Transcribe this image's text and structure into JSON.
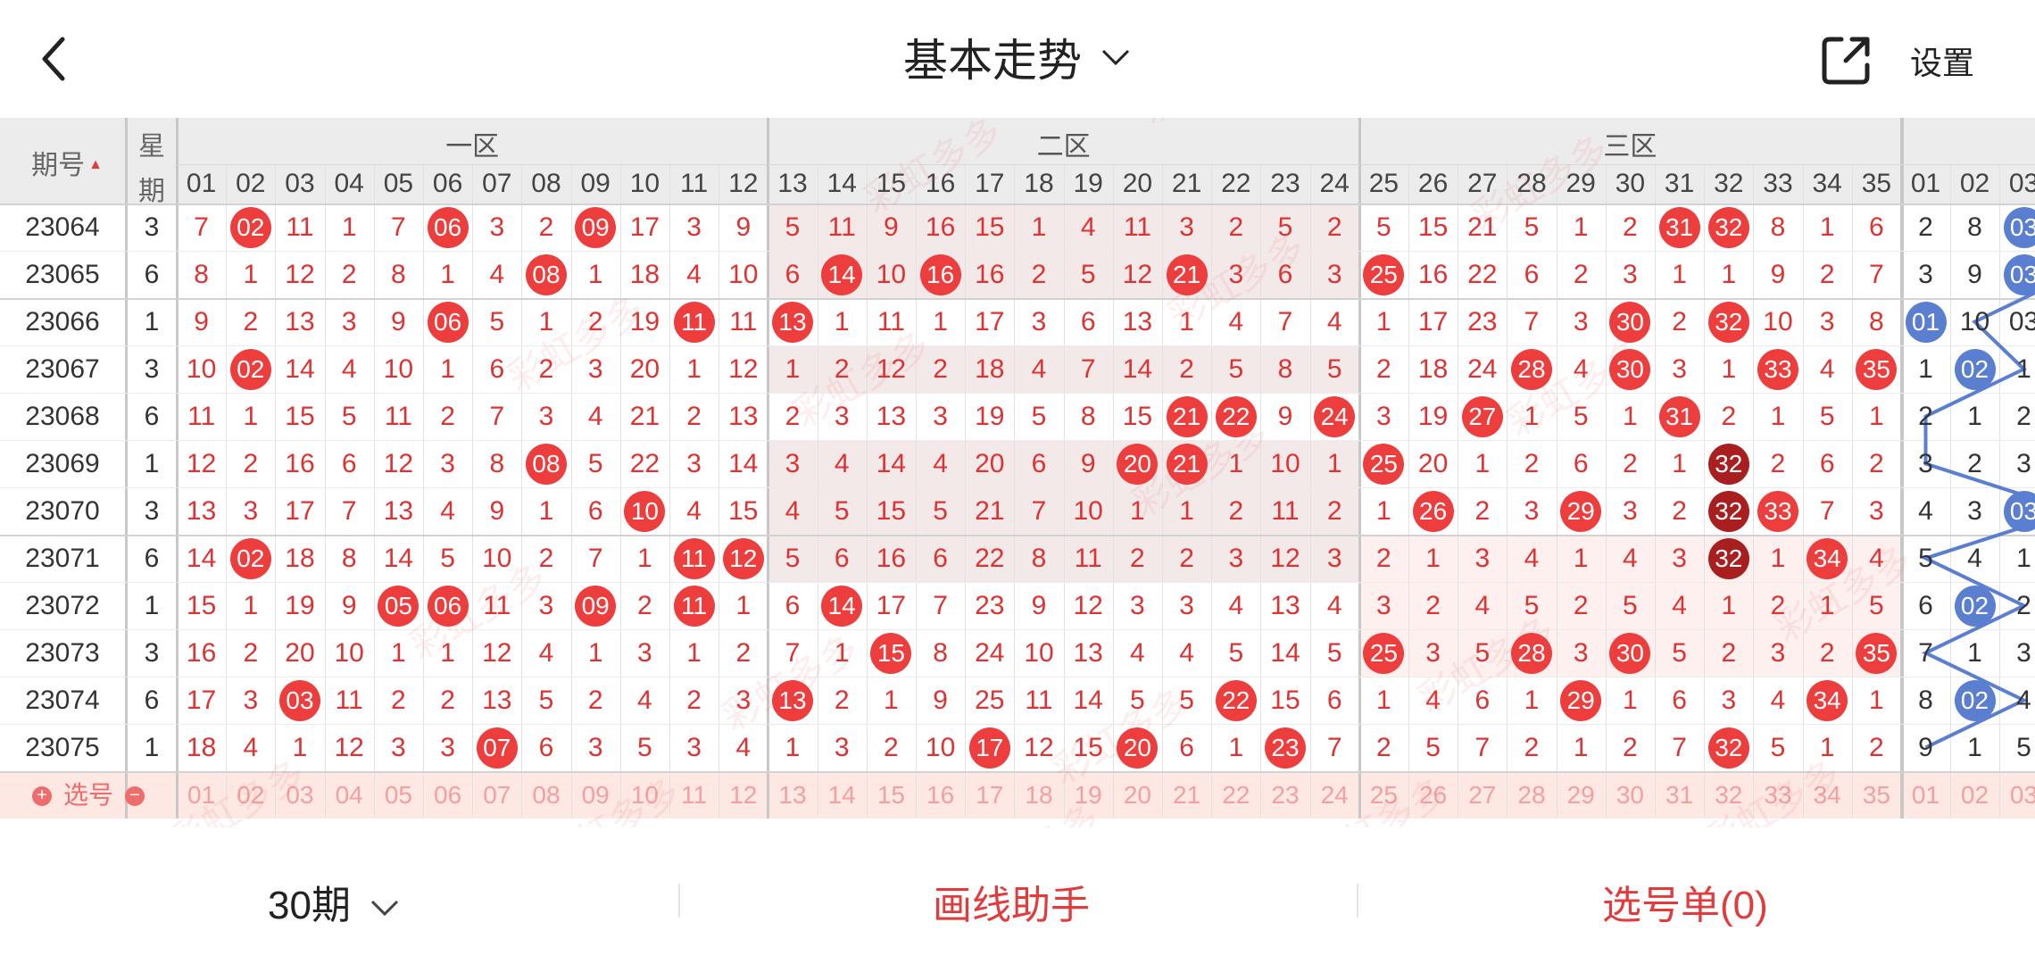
{
  "header": {
    "title": "基本走势",
    "settings_label": "设置"
  },
  "watermark": "彩虹多多",
  "columns": {
    "issue_label": "期号",
    "weekday_label": [
      "星",
      "期"
    ],
    "zones": [
      "一区",
      "二区",
      "三区"
    ],
    "red_numbers": [
      "01",
      "02",
      "03",
      "04",
      "05",
      "06",
      "07",
      "08",
      "09",
      "10",
      "11",
      "12",
      "13",
      "14",
      "15",
      "16",
      "17",
      "18",
      "19",
      "20",
      "21",
      "22",
      "23",
      "24",
      "25",
      "26",
      "27",
      "28",
      "29",
      "30",
      "31",
      "32",
      "33",
      "34",
      "35"
    ],
    "blue_numbers": [
      "01",
      "02",
      "03"
    ]
  },
  "rows": [
    {
      "issue": "23064",
      "weekday": "3",
      "red": [
        "7",
        "02",
        "11",
        "1",
        "7",
        "06",
        "3",
        "2",
        "09",
        "17",
        "3",
        "9",
        "5",
        "11",
        "9",
        "16",
        "15",
        "1",
        "4",
        "11",
        "3",
        "2",
        "5",
        "2",
        "5",
        "15",
        "21",
        "5",
        "1",
        "2",
        "31",
        "32",
        "8",
        "1",
        "6"
      ],
      "blue": [
        "2",
        "8",
        "03"
      ]
    },
    {
      "issue": "23065",
      "weekday": "6",
      "red": [
        "8",
        "1",
        "12",
        "2",
        "8",
        "1",
        "4",
        "08",
        "1",
        "18",
        "4",
        "10",
        "6",
        "14",
        "10",
        "16",
        "16",
        "2",
        "5",
        "12",
        "21",
        "3",
        "6",
        "3",
        "25",
        "16",
        "22",
        "6",
        "2",
        "3",
        "1",
        "1",
        "9",
        "2",
        "7"
      ],
      "blue": [
        "3",
        "9",
        "03"
      ]
    },
    {
      "issue": "23066",
      "weekday": "1",
      "red": [
        "9",
        "2",
        "13",
        "3",
        "9",
        "06",
        "5",
        "1",
        "2",
        "19",
        "11",
        "11",
        "13",
        "1",
        "11",
        "1",
        "17",
        "3",
        "6",
        "13",
        "1",
        "4",
        "7",
        "4",
        "1",
        "17",
        "23",
        "7",
        "3",
        "30",
        "2",
        "32",
        "10",
        "3",
        "8"
      ],
      "blue": [
        "01",
        "10",
        "03"
      ]
    },
    {
      "issue": "23067",
      "weekday": "3",
      "red": [
        "10",
        "02",
        "14",
        "4",
        "10",
        "1",
        "6",
        "2",
        "3",
        "20",
        "1",
        "12",
        "1",
        "2",
        "12",
        "2",
        "18",
        "4",
        "7",
        "14",
        "2",
        "5",
        "8",
        "5",
        "2",
        "18",
        "24",
        "28",
        "4",
        "30",
        "3",
        "1",
        "33",
        "4",
        "35"
      ],
      "blue": [
        "1",
        "02",
        "1"
      ]
    },
    {
      "issue": "23068",
      "weekday": "6",
      "red": [
        "11",
        "1",
        "15",
        "5",
        "11",
        "2",
        "7",
        "3",
        "4",
        "21",
        "2",
        "13",
        "2",
        "3",
        "13",
        "3",
        "19",
        "5",
        "8",
        "15",
        "21",
        "22",
        "9",
        "24",
        "3",
        "19",
        "27",
        "1",
        "5",
        "1",
        "31",
        "2",
        "1",
        "5",
        "1"
      ],
      "blue": [
        "2",
        "1",
        "2"
      ]
    },
    {
      "issue": "23069",
      "weekday": "1",
      "red": [
        "12",
        "2",
        "16",
        "6",
        "12",
        "3",
        "8",
        "08",
        "5",
        "22",
        "3",
        "14",
        "3",
        "4",
        "14",
        "4",
        "20",
        "6",
        "9",
        "20",
        "21",
        "1",
        "10",
        "1",
        "25",
        "20",
        "1",
        "2",
        "6",
        "2",
        "1",
        "32",
        "2",
        "6",
        "2"
      ],
      "blue": [
        "3",
        "2",
        "3"
      ]
    },
    {
      "issue": "23070",
      "weekday": "3",
      "red": [
        "13",
        "3",
        "17",
        "7",
        "13",
        "4",
        "9",
        "1",
        "6",
        "10",
        "4",
        "15",
        "4",
        "5",
        "15",
        "5",
        "21",
        "7",
        "10",
        "1",
        "1",
        "2",
        "11",
        "2",
        "1",
        "26",
        "2",
        "3",
        "29",
        "3",
        "2",
        "32",
        "33",
        "7",
        "3"
      ],
      "blue": [
        "4",
        "3",
        "03"
      ]
    },
    {
      "issue": "23071",
      "weekday": "6",
      "red": [
        "14",
        "02",
        "18",
        "8",
        "14",
        "5",
        "10",
        "2",
        "7",
        "1",
        "11",
        "12",
        "5",
        "6",
        "16",
        "6",
        "22",
        "8",
        "11",
        "2",
        "2",
        "3",
        "12",
        "3",
        "2",
        "1",
        "3",
        "4",
        "1",
        "4",
        "3",
        "32",
        "1",
        "34",
        "4"
      ],
      "blue": [
        "5",
        "4",
        "1"
      ]
    },
    {
      "issue": "23072",
      "weekday": "1",
      "red": [
        "15",
        "1",
        "19",
        "9",
        "05",
        "06",
        "11",
        "3",
        "09",
        "2",
        "11",
        "1",
        "6",
        "14",
        "17",
        "7",
        "23",
        "9",
        "12",
        "3",
        "3",
        "4",
        "13",
        "4",
        "3",
        "2",
        "4",
        "5",
        "2",
        "5",
        "4",
        "1",
        "2",
        "1",
        "5"
      ],
      "blue": [
        "6",
        "02",
        "2"
      ]
    },
    {
      "issue": "23073",
      "weekday": "3",
      "red": [
        "16",
        "2",
        "20",
        "10",
        "1",
        "1",
        "12",
        "4",
        "1",
        "3",
        "1",
        "2",
        "7",
        "1",
        "15",
        "8",
        "24",
        "10",
        "13",
        "4",
        "4",
        "5",
        "14",
        "5",
        "25",
        "3",
        "5",
        "28",
        "3",
        "30",
        "5",
        "2",
        "3",
        "2",
        "35"
      ],
      "blue": [
        "7",
        "1",
        "3"
      ]
    },
    {
      "issue": "23074",
      "weekday": "6",
      "red": [
        "17",
        "3",
        "03",
        "11",
        "2",
        "2",
        "13",
        "5",
        "2",
        "4",
        "2",
        "3",
        "13",
        "2",
        "1",
        "9",
        "25",
        "11",
        "14",
        "5",
        "5",
        "22",
        "15",
        "6",
        "1",
        "4",
        "6",
        "1",
        "29",
        "1",
        "6",
        "3",
        "4",
        "34",
        "1"
      ],
      "blue": [
        "8",
        "02",
        "4"
      ]
    },
    {
      "issue": "23075",
      "weekday": "1",
      "red": [
        "18",
        "4",
        "1",
        "12",
        "3",
        "3",
        "07",
        "6",
        "3",
        "5",
        "3",
        "4",
        "1",
        "3",
        "2",
        "10",
        "17",
        "12",
        "15",
        "20",
        "6",
        "1",
        "23",
        "7",
        "2",
        "5",
        "7",
        "2",
        "1",
        "2",
        "7",
        "32",
        "5",
        "1",
        "2"
      ],
      "blue": [
        "9",
        "1",
        "5"
      ]
    }
  ],
  "hits": {
    "red": [
      [
        2,
        6,
        9,
        31,
        32
      ],
      [
        8,
        14,
        16,
        21,
        25
      ],
      [
        6,
        11,
        13,
        30,
        32
      ],
      [
        2,
        28,
        30,
        33,
        35
      ],
      [
        21,
        22,
        24,
        27,
        31
      ],
      [
        8,
        20,
        21,
        25,
        32
      ],
      [
        10,
        26,
        29,
        32,
        33
      ],
      [
        2,
        11,
        12,
        32,
        34
      ],
      [
        5,
        6,
        9,
        11,
        14
      ],
      [
        15,
        25,
        28,
        30,
        35
      ],
      [
        3,
        13,
        22,
        29,
        34
      ],
      [
        7,
        17,
        20,
        23,
        32
      ]
    ],
    "blue": [
      3,
      3,
      1,
      2,
      0,
      0,
      3,
      0,
      2,
      0,
      2,
      0
    ]
  },
  "select_row": {
    "label": "选号"
  },
  "bottom": {
    "periods": "30期",
    "draw_helper": "画线助手",
    "pick_list": "选号单(0)"
  },
  "colors": {
    "red_ball": "#ee3d3d",
    "dark_red_ball": "#a91f1f",
    "blue_ball": "#5b7fd0",
    "accent": "#e23b3b"
  }
}
